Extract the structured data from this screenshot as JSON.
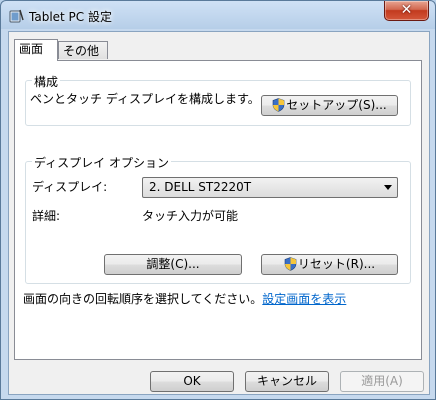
{
  "window": {
    "title": "Tablet PC 設定"
  },
  "tabs": [
    {
      "label": "画面"
    },
    {
      "label": "その他"
    }
  ],
  "config_group": {
    "title": "構成",
    "description": "ペンとタッチ ディスプレイを構成します。",
    "setup_button": "セットアップ(S)..."
  },
  "display_group": {
    "title": "ディスプレイ オプション",
    "display_label": "ディスプレイ:",
    "display_value": "2. DELL ST2220T",
    "details_label": "詳細:",
    "details_value": "タッチ入力が可能",
    "adjust_button": "調整(C)...",
    "reset_button": "リセット(R)..."
  },
  "rotation": {
    "text": "画面の向きの回転順序を選択してください。",
    "link": "設定画面を表示"
  },
  "footer": {
    "ok": "OK",
    "cancel": "キャンセル",
    "apply": "適用(A)"
  }
}
